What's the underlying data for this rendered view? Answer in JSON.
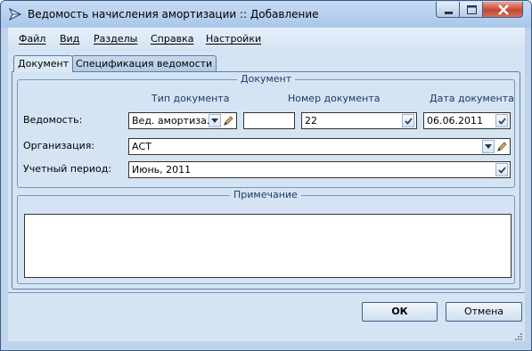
{
  "window": {
    "title": "Ведомость начисления амортизации :: Добавление",
    "icon": "app-arrow-icon",
    "controls": [
      "minimize-icon",
      "maximize-icon",
      "close-icon"
    ]
  },
  "menu": [
    "Файл",
    "Вид",
    "Разделы",
    "Справка",
    "Настройки"
  ],
  "tabs": [
    {
      "label": "Документ",
      "active": true
    },
    {
      "label": "Спецификация ведомости",
      "active": false
    }
  ],
  "document": {
    "group_title": "Документ",
    "columns": {
      "doc_type": "Тип документа",
      "doc_number": "Номер документа",
      "doc_date": "Дата документа"
    },
    "statement": {
      "label": "Ведомость:",
      "doc_type_value": "Вед. амортиза...",
      "series_value": "",
      "number_value": "22",
      "date_value": "06.06.2011"
    },
    "organization": {
      "label": "Организация:",
      "value": "АСТ"
    },
    "period": {
      "label": "Учетный период:",
      "value": "Июнь, 2011"
    }
  },
  "note": {
    "group_title": "Примечание",
    "value": ""
  },
  "buttons": {
    "ok": "ОК",
    "cancel": "Отмена"
  },
  "colors": {
    "frame": "#bfd3ea",
    "panel": "#d5e4f3",
    "group_title": "#1b3a66",
    "close_button": "#c74431"
  }
}
